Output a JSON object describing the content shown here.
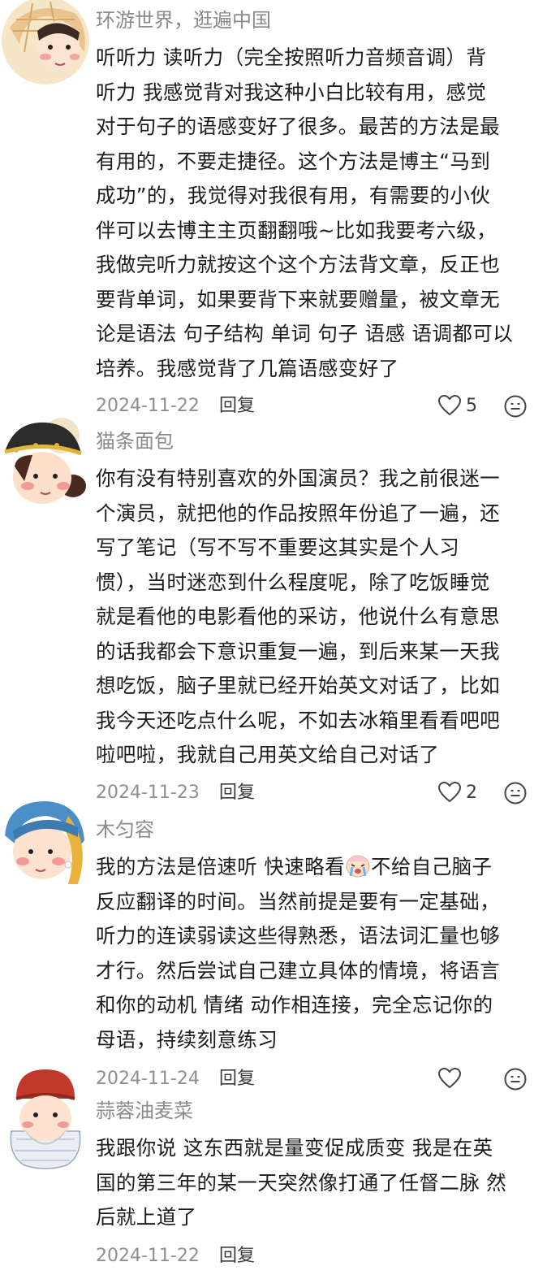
{
  "comments": [
    {
      "username": "环游世界，逛遍中国",
      "lines": [
        "听听力 读听力（完全按照听力音频音调）背",
        "听力  我感觉背对我这种小白比较有用，感觉",
        "对于句子的语感变好了很多。最苦的方法是最",
        "有用的，不要走捷径。这个方法是博主“马到",
        "成功”的，我觉得对我很有用，有需要的小伙",
        "伴可以去博主主页翻翻哦~比如我要考六级，",
        "我做完听力就按这个这个方法背文章，反正也",
        "要背单词，如果要背下来就要赠量，被文章无",
        "论是语法 句子结构 单词 句子 语感 语调都可以",
        "培养。我感觉背了几篇语感变好了"
      ],
      "date": "2024-11-22",
      "reply": "回复",
      "likes": "5"
    },
    {
      "username": "猫条面包",
      "lines": [
        "你有没有特别喜欢的外国演员？我之前很迷一",
        "个演员，就把他的作品按照年份追了一遍，还",
        "写了笔记（写不写不重要这其实是个人习",
        "惯），当时迷恋到什么程度呢，除了吃饭睡觉",
        "就是看他的电影看他的采访，他说什么有意思",
        "的话我都会下意识重复一遍，到后来某一天我",
        "想吃饭，脑子里就已经开始英文对话了，比如",
        "我今天还吃点什么呢，不如去冰箱里看看吧吧",
        "啦吧啦，我就自己用英文给自己对话了"
      ],
      "date": "2024-11-23",
      "reply": "回复",
      "likes": "2"
    },
    {
      "username": "木匀容",
      "line1_before": "我的方法是倍速听 快速略看",
      "line1_after": "不给自己脑子",
      "lines": [
        "反应翻译的时间。当然前提是要有一定基础，",
        "听力的连读弱读这些得熟悉，语法词汇量也够",
        "才行。然后尝试自己建立具体的情境，将语言",
        "和你的动机 情绪 动作相连接，完全忘记你的",
        "母语，持续刻意练习"
      ],
      "date": "2024-11-24",
      "reply": "回复",
      "likes": ""
    },
    {
      "username": "蒜蓉油麦菜",
      "lines": [
        "我跟你说 这东西就是量变促成质变 我是在英",
        "国的第三年的某一天突然像打通了任督二脉 然",
        "后就上道了"
      ],
      "date": "2024-11-22",
      "reply": "回复",
      "likes": ""
    }
  ],
  "icons": {
    "like": "heart-outline-icon",
    "emoji": "smiley-face-icon",
    "inline_emoji": "crying-face-emoji"
  },
  "colors": {
    "username": "#8a8a8a",
    "text": "#1c1c1c",
    "date": "#8f8f8f",
    "icon": "#444444"
  }
}
